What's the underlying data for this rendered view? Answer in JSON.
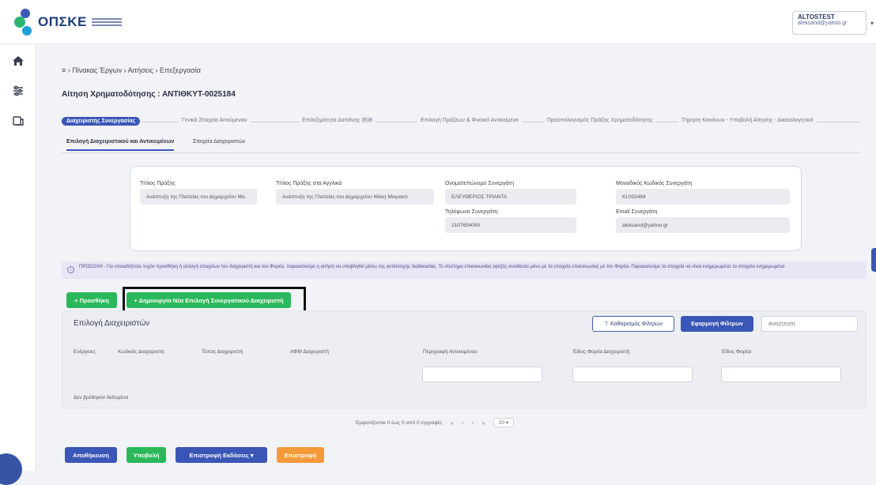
{
  "brand": {
    "name": "ΟΠΣΚΕ"
  },
  "user": {
    "username": "ALTOSTEST",
    "email": "aleksand@yahoo.gr"
  },
  "sidebar": {
    "items": [
      {
        "icon": "home-icon"
      },
      {
        "icon": "sliders-icon"
      },
      {
        "icon": "projects-icon"
      }
    ]
  },
  "breadcrumb": "≡ › Πίνακας Έργων › Αιτήσεις › Επεξεργασία",
  "page_title": "Αίτηση Χρηματοδότησης : ΑΝΤΙΘΚΥΤ-0025184",
  "steps": [
    "Διαχειριστής Συνεργασίας",
    "Γενικά Στοιχεία Αιτούμενου",
    "Επιλεξιμότητα Δαπάνης (Β)Β",
    "Επιλογή Πράξεων & Φυσικό Αντικείμενο",
    "Προϋπολογισμός Πράξης Χρηματοδότησης",
    "Τήρηση Κανόνων - Υποβολή Αίτησης - Δικαιολογητικά"
  ],
  "subtabs": [
    "Επιλογή Διαχειριστικού και Αντικειμένων",
    "Στοιχεία Διαχειριστών"
  ],
  "details": {
    "project_title": {
      "label": "Τίτλος Πράξης",
      "value": "Ανάπτυξη της Πλατείας του Δημαρχείου Ιθα."
    },
    "project_title_foreign": {
      "label": "Τίτλος Πράξης στα Αγγλικά",
      "value": "Ανάπτυξη της Πλατείας του Δημαρχείου Ιθάκη Μαιρακτι"
    },
    "partner_name": {
      "label": "Ονοματεπώνυμο Συνεργάτη",
      "value": "ΕΛΕΥΘΕΡΙΟΣ ΤΡΙΑΝΤΑ"
    },
    "partner_phone": {
      "label": "Τηλέφωνο Συνεργάτη",
      "value": "2107654000"
    },
    "partner_code": {
      "label": "Μοναδικός Κωδικός Συνεργάτη",
      "value": "KL002484"
    },
    "partner_email": {
      "label": "Email Συνεργάτη",
      "value": "aleksand@yahoo.gr"
    }
  },
  "info_banner": "ΠΡΟΣΟΧΗ - Για οποιαδήποτε τυχόν προσθήκη ή αλλαγή στοιχείων του διαχειριστή και του Φορέα, παρακαλούμε η αιτήση να υποβληθεί μέσω της αντίστοιχης διαδικασίας. Το σύστημα επικοινωνίας εφεξής συνδέεται μόνο με τα στοιχεία επικοινωνίας με τον Φορέα. Παρακαλούμε τα στοιχεία να είναι ενημερωμένα τα στοιχεία ενημερωμένα",
  "actions": {
    "add_label": "+ Προσθήκη",
    "create_label": "+ Δημιουργία Νέα Επιλογή Συνεργατικού Διαχειριστή"
  },
  "table": {
    "title": "Επιλογή Διαχειριστών",
    "filter_button": "⊤ Καθαρισμός Φίλτρων",
    "apply_button": "Εφαρμογή Φίλτρων",
    "search_placeholder": "Αναζήτηση",
    "columns": [
      "Ενέργειες",
      "Κωδικός Διαχειριστή",
      "Τύπος Διαχειριστή",
      "ΑΦΜ Διαχειριστή",
      "Περιγραφή Αντικειμένου",
      "Είδος Φορέα Διαχειριστή",
      "Είδος Φορέα"
    ],
    "empty_text": "Δεν βρέθηκαν δεδομένα"
  },
  "pagination": {
    "summary": "Εμφανίζονται 0 έως 0 από 0 εγγραφές",
    "first": "«",
    "prev": "‹",
    "next": "›",
    "last": "»",
    "page_size": "20 ▾"
  },
  "footer": {
    "save": "Αποθήκευση",
    "next": "Υποβολή",
    "previous": "Επιστροφή Εκδόσεις ▾",
    "cancel": "Επιστροφή"
  },
  "colors": {
    "primary": "#3a57b7",
    "success": "#2bb85a",
    "warning": "#f59a3a",
    "info_bg": "#e7e5f6"
  }
}
